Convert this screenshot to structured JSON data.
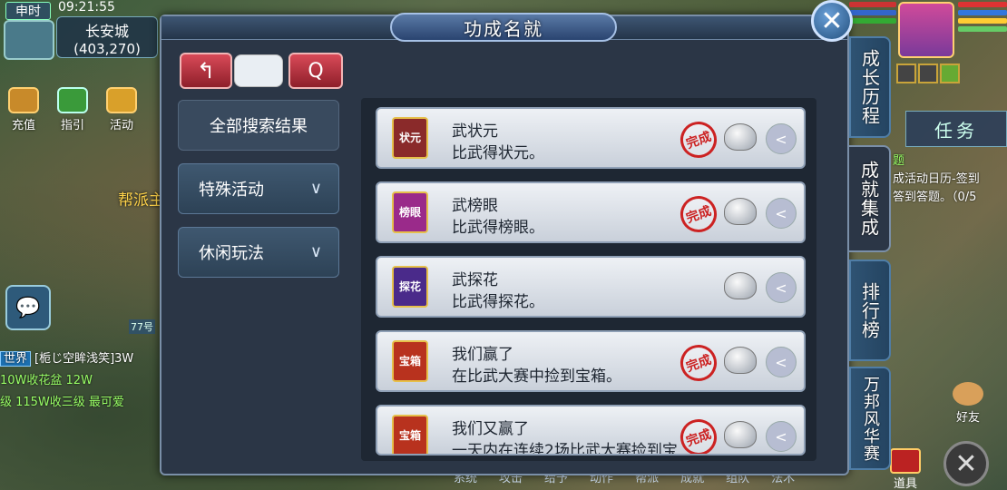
{
  "hud": {
    "time_tag": "申时",
    "clock": "09:21:55",
    "location_name": "长安城",
    "location_coords": "(403,270)",
    "top_icons": [
      {
        "label": "充值",
        "icon": "recharge-icon"
      },
      {
        "label": "指引",
        "icon": "guide-icon"
      },
      {
        "label": "活动",
        "icon": "activity-icon"
      }
    ],
    "side_label": "帮派主",
    "map_label": "77号"
  },
  "world_chat": {
    "tag": "世界",
    "lines": [
      "[栀じ空眸浅笑]3W",
      "10W收花盆  12W",
      "级  115W收三级  最可爱"
    ]
  },
  "right_hud": {
    "task_tab": "任务",
    "task_title": "题",
    "task_line1": "成活动日历-签到",
    "task_line2": "答到答题。（0/5",
    "friend_label": "好友",
    "bag_label": "道具",
    "bottom_menu": [
      "系统",
      "攻击",
      "给予",
      "动作",
      "帮派",
      "成就",
      "组队",
      "法术"
    ]
  },
  "panel": {
    "title": "功成名就",
    "close_symbol": "✕",
    "back_symbol": "↰",
    "search_placeholder": "",
    "search_symbol": "Q"
  },
  "categories": [
    {
      "label": "全部搜索结果",
      "active": true
    },
    {
      "label": "特殊活动",
      "chevron": "∨"
    },
    {
      "label": "休闲玩法",
      "chevron": "∨"
    }
  ],
  "achievements": [
    {
      "name": "武状元",
      "desc": "比武得状元。",
      "icon_text": "状元",
      "icon_color": "#8a2a2a",
      "completed": true,
      "stamp": "完成"
    },
    {
      "name": "武榜眼",
      "desc": "比武得榜眼。",
      "icon_text": "榜眼",
      "icon_color": "#9a2a8a",
      "completed": true,
      "stamp": "完成"
    },
    {
      "name": "武探花",
      "desc": "比武得探花。",
      "icon_text": "探花",
      "icon_color": "#4a2a8a",
      "completed": false
    },
    {
      "name": "我们赢了",
      "desc": "在比武大赛中捡到宝箱。",
      "icon_text": "宝箱",
      "icon_color": "#b8321e",
      "completed": true,
      "stamp": "完成"
    },
    {
      "name": "我们又赢了",
      "desc": "一天内在连续2场比武大赛捡到宝",
      "icon_text": "宝箱",
      "icon_color": "#b8321e",
      "completed": true,
      "stamp": "完成"
    }
  ],
  "share_symbol": "<",
  "side_tabs": [
    {
      "label": "成长历程",
      "active": false
    },
    {
      "label": "成就集成",
      "active": true
    },
    {
      "label": "排行榜",
      "active": false
    },
    {
      "label": "万邦风华赛",
      "active": false
    }
  ]
}
